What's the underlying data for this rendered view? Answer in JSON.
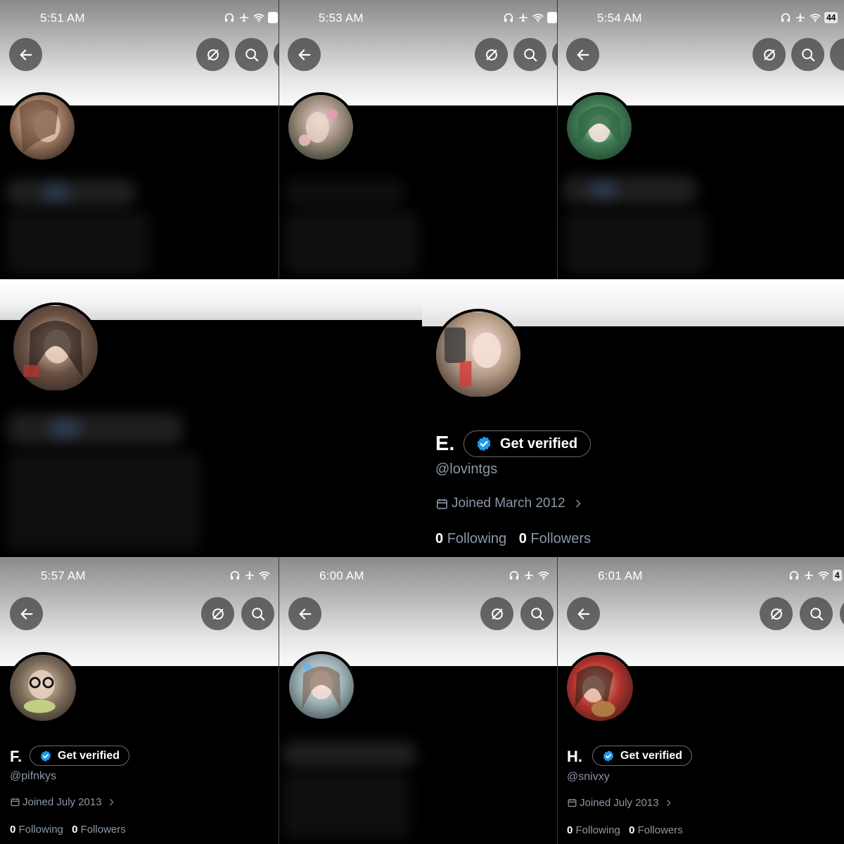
{
  "colors": {
    "verified_badge": "#1d9bf0",
    "muted_text": "#8b98a5",
    "background": "#000000"
  },
  "icons": [
    "back-arrow-icon",
    "hide-icon",
    "search-icon",
    "headphones-icon",
    "airplane-icon",
    "wifi-icon",
    "battery-icon",
    "calendar-icon",
    "chevron-right-icon",
    "verified-badge-icon"
  ],
  "panels": {
    "a": {
      "time": "5:51 AM"
    },
    "b": {
      "time": "5:53 AM"
    },
    "c": {
      "time": "5:54 AM",
      "battery": "44"
    },
    "e": {
      "name": "E.",
      "verify_label": "Get verified",
      "handle": "@lovintgs",
      "joined": "Joined March 2012",
      "following_count": "0",
      "following_label": "Following",
      "followers_count": "0",
      "followers_label": "Followers"
    },
    "f": {
      "time": "5:57 AM",
      "name": "F.",
      "verify_label": "Get verified",
      "handle": "@pifnkys",
      "joined": "Joined July 2013",
      "following_count": "0",
      "following_label": "Following",
      "followers_count": "0",
      "followers_label": "Followers"
    },
    "g": {
      "time": "6:00 AM"
    },
    "h": {
      "time": "6:01 AM",
      "battery": "4",
      "name": "H.",
      "verify_label": "Get verified",
      "handle": "@snivxy",
      "joined": "Joined July 2013",
      "following_count": "0",
      "following_label": "Following",
      "followers_count": "0",
      "followers_label": "Followers"
    }
  }
}
